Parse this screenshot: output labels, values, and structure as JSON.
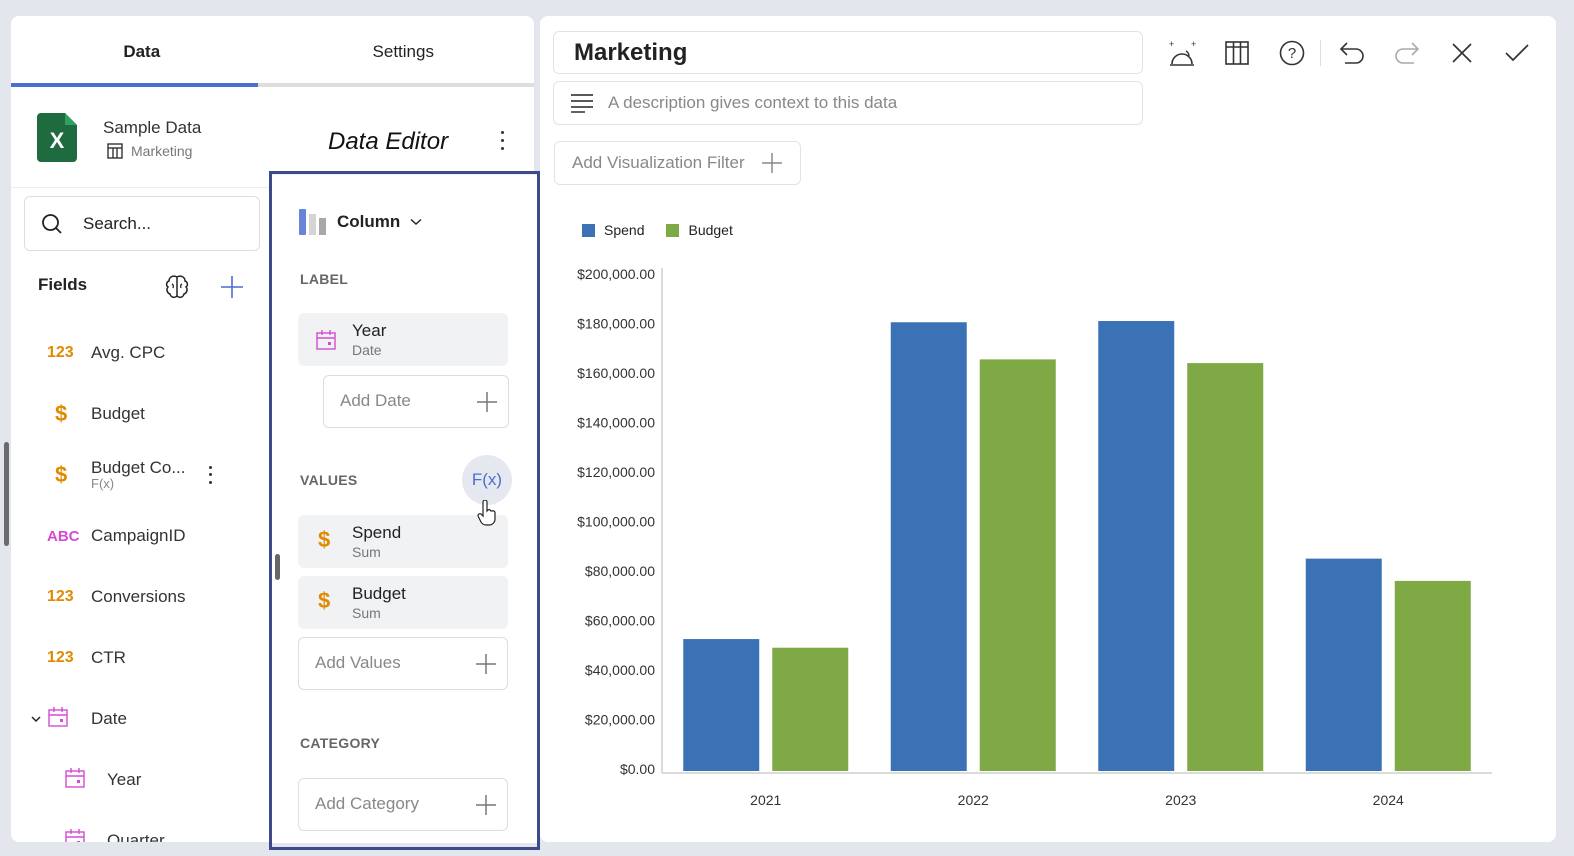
{
  "tabs": [
    {
      "label": "Data",
      "active": true
    },
    {
      "label": "Settings",
      "active": false
    }
  ],
  "source": {
    "name": "Sample Data",
    "sheet": "Marketing",
    "icon": "excel-icon"
  },
  "editor_title": "Data Editor",
  "search": {
    "placeholder": "Search..."
  },
  "fields_header": "Fields",
  "fields": [
    {
      "type": "number",
      "type_label": "123",
      "label": "Avg. CPC"
    },
    {
      "type": "currency",
      "type_label": "$",
      "label": "Budget"
    },
    {
      "type": "currency",
      "type_label": "$",
      "label": "Budget Co...",
      "sub": "F(x)",
      "has_menu": true
    },
    {
      "type": "text",
      "type_label": "ABC",
      "label": "CampaignID"
    },
    {
      "type": "number",
      "type_label": "123",
      "label": "Conversions"
    },
    {
      "type": "number",
      "type_label": "123",
      "label": "CTR"
    },
    {
      "type": "date",
      "label": "Date",
      "expanded": true
    },
    {
      "type": "date",
      "label": "Year",
      "child": true
    },
    {
      "type": "date",
      "label": "Quarter",
      "child": true
    }
  ],
  "editor": {
    "viz_type": "Column",
    "label_section": "LABEL",
    "label_field": {
      "name": "Year",
      "sub": "Date"
    },
    "add_date": "Add Date",
    "values_section": "VALUES",
    "fx_label": "F(x)",
    "values": [
      {
        "name": "Spend",
        "sub": "Sum"
      },
      {
        "name": "Budget",
        "sub": "Sum"
      }
    ],
    "add_values": "Add Values",
    "category_section": "CATEGORY",
    "add_category": "Add Category"
  },
  "visualization": {
    "title": "Marketing",
    "description_placeholder": "A description gives context to this data",
    "filter_button": "Add Visualization Filter"
  },
  "toolbar": [
    "magic-icon",
    "grid-icon",
    "help-icon",
    "undo-icon",
    "redo-icon",
    "close-icon",
    "check-icon"
  ],
  "colors": {
    "accent": "#4a6fd1",
    "spend": "#3b72b6",
    "budget": "#7ea945",
    "currency_icon": "#e08a00",
    "date_icon": "#d54bd3",
    "highlight_border": "#3a4a8c"
  },
  "chart_data": {
    "type": "bar",
    "title": "",
    "xlabel": "",
    "ylabel": "",
    "categories": [
      "2021",
      "2022",
      "2023",
      "2024"
    ],
    "series": [
      {
        "name": "Spend",
        "values": [
          52500,
          180500,
          181000,
          85000
        ]
      },
      {
        "name": "Budget",
        "values": [
          49000,
          165500,
          164000,
          76000
        ]
      }
    ],
    "ylim": [
      0,
      200000
    ],
    "yticks": [
      0,
      20000,
      40000,
      60000,
      80000,
      100000,
      120000,
      140000,
      160000,
      180000,
      200000
    ],
    "ytick_labels": [
      "$0.00",
      "$20,000.00",
      "$40,000.00",
      "$60,000.00",
      "$80,000.00",
      "$100,000.00",
      "$120,000.00",
      "$140,000.00",
      "$160,000.00",
      "$180,000.00",
      "$200,000.00"
    ],
    "grid": false,
    "legend": "top-left"
  }
}
